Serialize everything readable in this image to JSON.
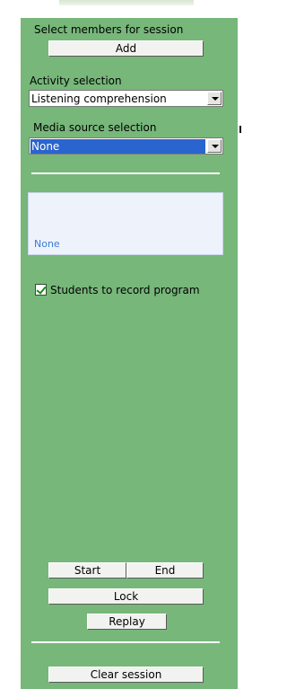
{
  "members": {
    "label": "Select members for session",
    "add_button": "Add"
  },
  "activity": {
    "label": "Activity selection",
    "selected": "Listening comprehension"
  },
  "media": {
    "label": "Media source selection",
    "selected": "None"
  },
  "source_list": {
    "item": "None"
  },
  "record": {
    "label": "Students to record program",
    "checked": true
  },
  "controls": {
    "start": "Start",
    "end": "End",
    "lock": "Lock",
    "replay": "Replay",
    "clear": "Clear session"
  },
  "colors": {
    "panel": "#77b77a",
    "selection": "#2a64cf",
    "list_text": "#3b7ad8"
  }
}
